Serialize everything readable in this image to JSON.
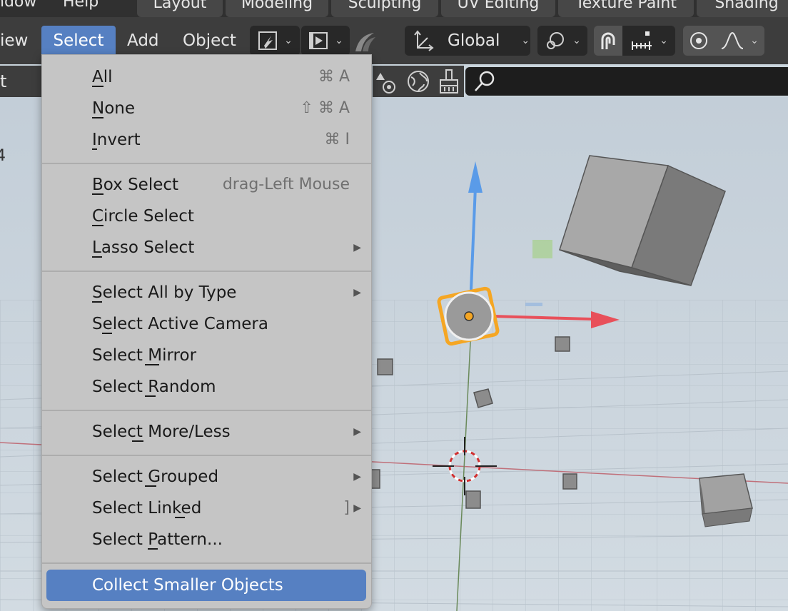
{
  "workspace_tabs": {
    "left_fragment": "ndow",
    "help_fragment": "Help",
    "tabs": [
      "Layout",
      "Modeling",
      "Sculpting",
      "UV Editing",
      "Texture Paint",
      "Shading"
    ]
  },
  "header": {
    "view_fragment": "iew",
    "select_label": "Select",
    "add_label": "Add",
    "object_label": "Object",
    "orientation_label": "Global"
  },
  "subbar": {
    "left_fragment": "t"
  },
  "viewport": {
    "axis_fragment": "4"
  },
  "select_menu": {
    "items": [
      {
        "label": "All",
        "shortcut": "⌘ A"
      },
      {
        "label": "None",
        "shortcut": "⇧ ⌘ A"
      },
      {
        "label": "Invert",
        "shortcut": "⌘ I"
      },
      {
        "label": "Box Select",
        "shortcut": "drag-Left Mouse"
      },
      {
        "label": "Circle Select"
      },
      {
        "label": "Lasso Select"
      },
      {
        "label": "Select All by Type"
      },
      {
        "label": "Select Active Camera"
      },
      {
        "label": "Select Mirror"
      },
      {
        "label": "Select Random"
      },
      {
        "label": "Select More/Less"
      },
      {
        "label": "Select Grouped"
      },
      {
        "label": "Select Linked",
        "shortcut": "]"
      },
      {
        "label": "Select Pattern..."
      },
      {
        "label": "Collect Smaller Objects"
      }
    ]
  },
  "colors": {
    "accent": "#5680c2",
    "menu_bg": "#c5c5c5",
    "header_bg": "#3d3d3d",
    "x_axis": "#e8505a",
    "z_axis": "#5a9be8",
    "selected_outline": "#f5a623"
  }
}
